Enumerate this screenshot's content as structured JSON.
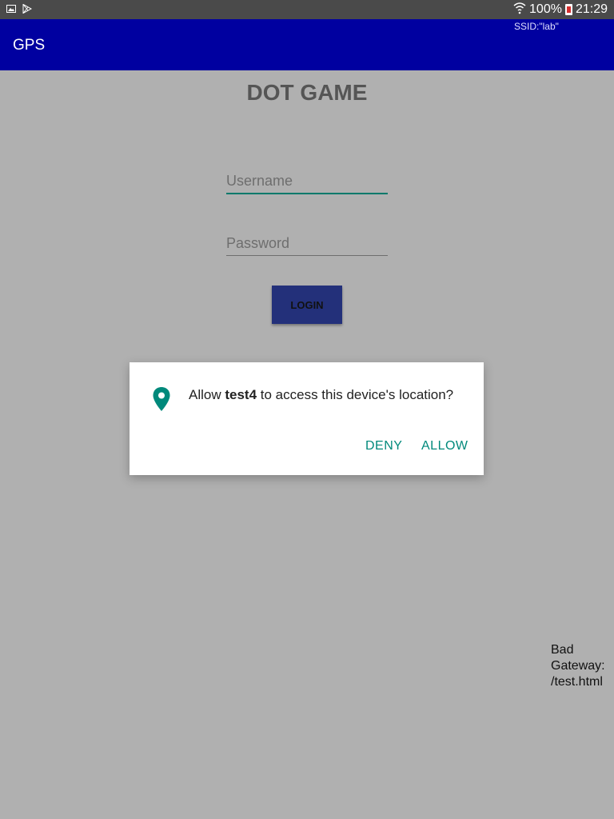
{
  "status_bar": {
    "battery": "100%",
    "time": "21:29",
    "icons": [
      "gallery-icon",
      "play-store-icon",
      "wifi-icon",
      "battery-icon"
    ]
  },
  "app_bar": {
    "title": "GPS",
    "ssid": "SSID:\"lab\""
  },
  "main": {
    "game_title": "DOT GAME",
    "username_placeholder": "Username",
    "password_placeholder": "Password",
    "login_label": "LOGIN"
  },
  "dialog": {
    "message_prefix": "Allow ",
    "app_name": "test4",
    "message_suffix": " to access this device's location?",
    "deny_label": "DENY",
    "allow_label": "ALLOW"
  },
  "error": {
    "text": "Bad Gateway: /test.html"
  },
  "colors": {
    "app_bar": "#0000a0",
    "accent": "#00897b",
    "login_button": "#23307a",
    "scrim_background": "#b0b0b0"
  }
}
